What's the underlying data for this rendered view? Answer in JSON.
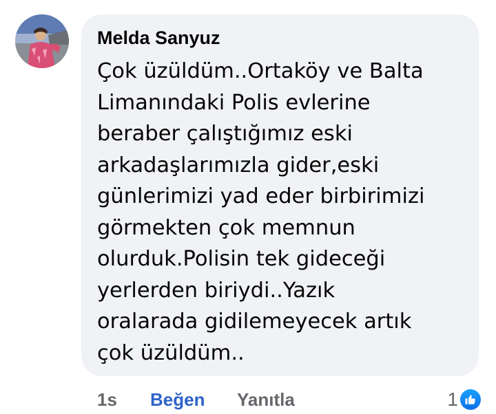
{
  "comment": {
    "author": "Melda Sanyuz",
    "lines": [
      "Çok üzüldüm..Ortaköy ve Balta",
      "Limanındaki Polis evlerine",
      "beraber çalıştığımız eski",
      "arkadaşlarımızla gider,eski",
      "günlerimizi yad eder birbirimizi",
      "görmekten çok memnun",
      "olurduk.Polisin tek gideceği",
      "yerlerden biriydi..Yazık",
      "oralarada gidilemeyecek artık",
      "çok üzüldüm.."
    ]
  },
  "actions": {
    "time": "1s",
    "like_label": "Beğen",
    "reply_label": "Yanıtla"
  },
  "reactions": {
    "count": "1",
    "icon": "thumbs-up-icon"
  },
  "colors": {
    "bubble": "#f0f2f5",
    "like_link": "#2d63c8",
    "meta_text": "#65676b",
    "reaction_badge": "#1877f2"
  }
}
